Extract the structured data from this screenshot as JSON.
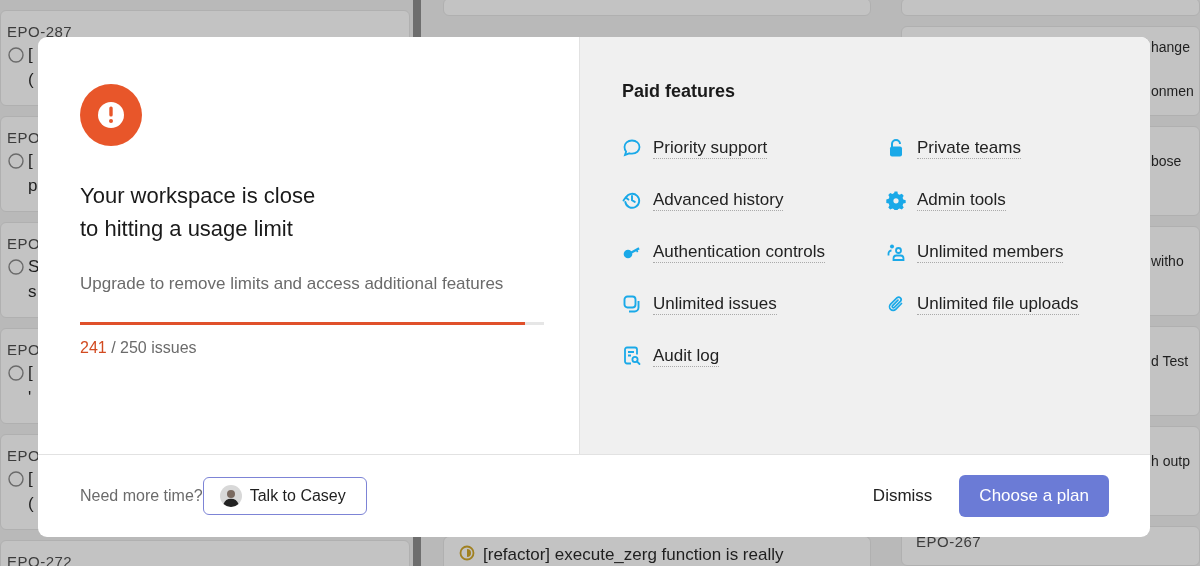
{
  "background": {
    "left_cards": [
      {
        "id": "EPO-287",
        "lines": [
          "[",
          "("
        ]
      },
      {
        "id": "EPO",
        "lines": [
          "[",
          "p"
        ]
      },
      {
        "id": "EPO",
        "lines": [
          "S",
          "s"
        ]
      },
      {
        "id": "EPO",
        "lines": [
          "[",
          "'"
        ]
      },
      {
        "id": "EPO",
        "lines": [
          "[",
          "("
        ]
      },
      {
        "id": "EPO-272"
      }
    ],
    "middle_card": {
      "title": "[refactor] execute_zerg function is really"
    },
    "right_cards": [
      {
        "lines": [
          "hange",
          "onmen"
        ]
      },
      {
        "lines": [
          "bose"
        ]
      },
      {
        "lines": [
          "witho"
        ]
      },
      {
        "lines": [
          "d Test"
        ]
      },
      {
        "lines": [
          "h outp"
        ]
      }
    ],
    "right_last_id": "EPO-267"
  },
  "dialog": {
    "title_lines": [
      "Your workspace is close",
      "to hitting a usage limit"
    ],
    "description": "Upgrade to remove limits and access additional features",
    "usage": {
      "level": 0.96,
      "used": "241",
      "limit": "/ 250 issues"
    },
    "paid_features": {
      "title": "Paid features",
      "columns": [
        [
          "Priority support",
          "Advanced history",
          "Authentication controls",
          "Unlimited issues",
          "Audit log"
        ],
        [
          "Private teams",
          "Admin tools",
          "Unlimited members",
          "Unlimited file uploads"
        ]
      ]
    },
    "footer": {
      "prompt": "Need more time?",
      "talk_button": "Talk to Casey",
      "dismiss": "Dismiss",
      "primary": "Choose a plan"
    }
  }
}
